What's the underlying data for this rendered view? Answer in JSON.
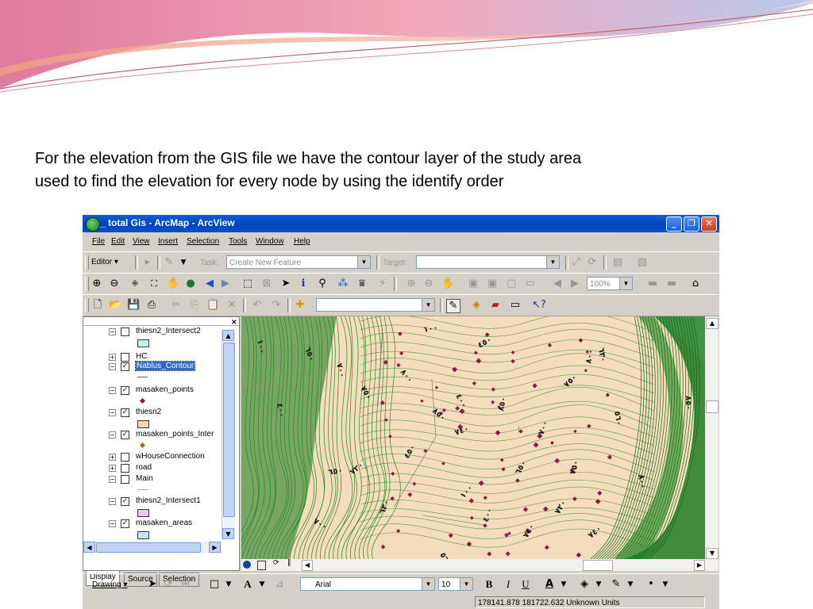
{
  "slide": {
    "caption": "For the elevation from the GIS file we have the contour layer of the study area used to find the elevation for every node by using the identify order"
  },
  "window": {
    "title": "_ total Gis - ArcMap - ArcView",
    "minimize": "_",
    "maximize": "❐",
    "close": "✕"
  },
  "menu": [
    "File",
    "Edit",
    "View",
    "Insert",
    "Selection",
    "Tools",
    "Window",
    "Help"
  ],
  "editor_toolbar": {
    "editor_label": "Editor ▾",
    "task_label": "Task:",
    "task_value": "Create New Feature",
    "target_label": "Target:",
    "target_value": ""
  },
  "tools_toolbar": {
    "zoom_value": "100%"
  },
  "standard_toolbar": {
    "scale_value": ""
  },
  "toc": {
    "close": "×",
    "layers": [
      {
        "name": "thiesn2_Intersect2",
        "checked": false,
        "expanded": true,
        "symbol": "box",
        "color": "#c8f0f0"
      },
      {
        "name": "HC",
        "checked": false,
        "expanded": false,
        "symbol": "none"
      },
      {
        "name": "Nablus_Contour",
        "checked": true,
        "expanded": true,
        "symbol": "line",
        "color": "#2e8b2e",
        "selected": true
      },
      {
        "name": "masaken_points",
        "checked": true,
        "expanded": true,
        "symbol": "dot",
        "color": "#8b1a4a"
      },
      {
        "name": "thiesn2",
        "checked": true,
        "expanded": true,
        "symbol": "box",
        "color": "#f5d5b0"
      },
      {
        "name": "masaken_points_Inter",
        "checked": true,
        "expanded": true,
        "symbol": "dot",
        "color": "#b06a20"
      },
      {
        "name": "wHouseConnection",
        "checked": false,
        "expanded": false,
        "symbol": "none"
      },
      {
        "name": "road",
        "checked": false,
        "expanded": false,
        "symbol": "none"
      },
      {
        "name": "Main",
        "checked": false,
        "expanded": true,
        "symbol": "line",
        "color": "#c8a070"
      },
      {
        "name": "thiesn2_Intersect1",
        "checked": true,
        "expanded": true,
        "symbol": "box",
        "color": "#e8c8ec"
      },
      {
        "name": "masaken_areas",
        "checked": true,
        "expanded": true,
        "symbol": "box",
        "color": "#c8e4f0"
      }
    ],
    "tabs": [
      "Display",
      "Source",
      "Selection"
    ]
  },
  "map": {
    "contour_labels": [
      "١٠٠",
      "٤٠٠",
      "٦٥٠",
      "٧٠٠",
      "٧٥٠",
      "٨٠٠",
      "٨٥٠",
      "٧٤٠",
      "٧٢٠",
      "٦٣٠",
      "٥٦٠",
      "٤٥٠"
    ],
    "colors": {
      "land": "#f5dcbd",
      "contour": "#1f8a1f",
      "dense": "#13781b",
      "points": "#8b1a4a",
      "boundary": "#6b6b6b"
    }
  },
  "drawing_toolbar": {
    "drawing_label": "Drawing ▾",
    "font_name": "Arial",
    "font_size": "10",
    "bold": "B",
    "italic": "I",
    "underline": "U"
  },
  "status": {
    "coordinates": "178141.878  181722.632 Unknown Units"
  }
}
